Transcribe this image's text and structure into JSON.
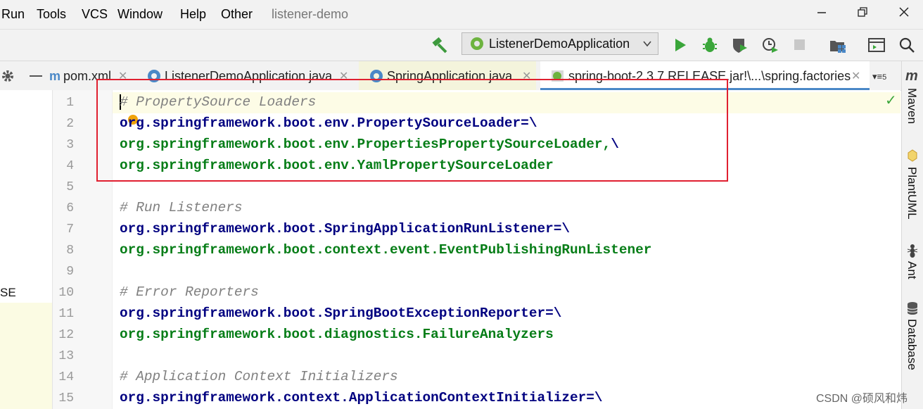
{
  "menu": {
    "run": "Run",
    "tools": "Tools",
    "vcs": "VCS",
    "window": "Window",
    "help": "Help",
    "other": "Other",
    "project": "listener-demo"
  },
  "toolbar": {
    "run_config": "ListenerDemoApplication"
  },
  "tabs": [
    {
      "label": "pom.xml"
    },
    {
      "label": "ListenerDemoApplication.java"
    },
    {
      "label": "SpringApplication.java"
    },
    {
      "label": "spring-boot-2.3.7.RELEASE.jar!\\...\\spring.factories"
    }
  ],
  "tab_overflow_count": "5",
  "left_panel": {
    "fragment": "SE"
  },
  "line_numbers": [
    "1",
    "2",
    "3",
    "4",
    "5",
    "6",
    "7",
    "8",
    "9",
    "10",
    "11",
    "12",
    "13",
    "14",
    "15"
  ],
  "code": [
    {
      "comment": "# PropertySource Loaders"
    },
    {
      "key": "org.springframework.boot.env.PropertySourceLoader=\\"
    },
    {
      "val": "org.springframework.boot.env.PropertiesPropertySourceLoader,",
      "tail": "\\"
    },
    {
      "val": "org.springframework.boot.env.YamlPropertySourceLoader"
    },
    {},
    {
      "comment": "# Run Listeners"
    },
    {
      "key": "org.springframework.boot.SpringApplicationRunListener=\\"
    },
    {
      "val": "org.springframework.boot.context.event.EventPublishingRunListener"
    },
    {},
    {
      "comment": "# Error Reporters"
    },
    {
      "key": "org.springframework.boot.SpringBootExceptionReporter=\\"
    },
    {
      "val": "org.springframework.boot.diagnostics.FailureAnalyzers"
    },
    {},
    {
      "comment": "# Application Context Initializers"
    },
    {
      "key": "org.springframework.context.ApplicationContextInitializer=\\"
    }
  ],
  "right_tools": {
    "maven": "Maven",
    "plantuml": "PlantUML",
    "ant": "Ant",
    "database": "Database"
  },
  "watermark": "CSDN @硕风和炜",
  "colors": {
    "key": "#000080",
    "value": "#067d17",
    "comment": "#808080",
    "highlight_box": "#e02030",
    "active_tab_underline": "#4a88c7"
  }
}
